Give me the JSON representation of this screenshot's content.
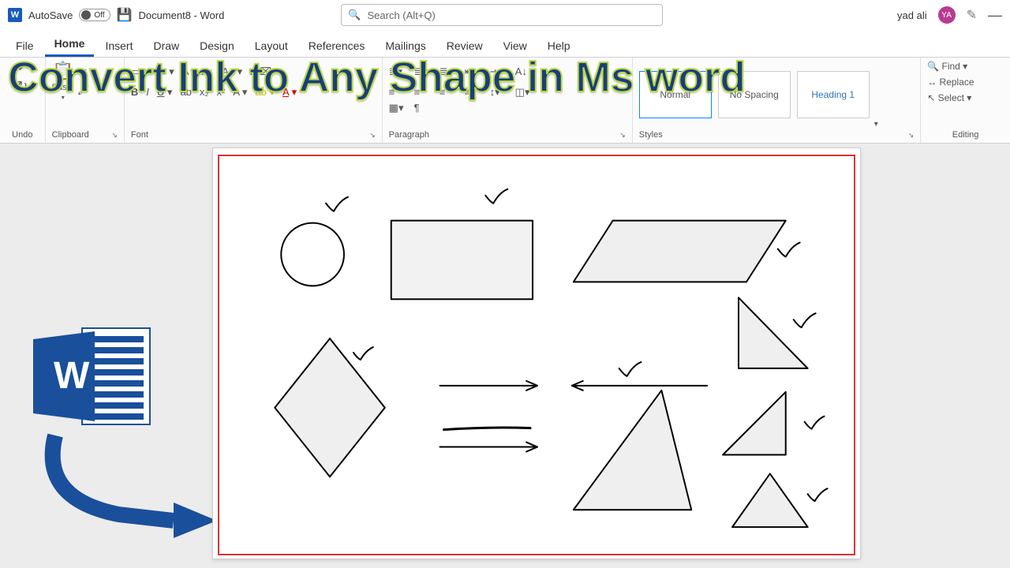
{
  "titlebar": {
    "autosave_label": "AutoSave",
    "autosave_state": "Off",
    "doc_title": "Document8 - Word",
    "search_placeholder": "Search (Alt+Q)",
    "user_name": "yad ali",
    "user_initials": "YA"
  },
  "tabs": [
    "File",
    "Home",
    "Insert",
    "Draw",
    "Design",
    "Layout",
    "References",
    "Mailings",
    "Review",
    "View",
    "Help"
  ],
  "active_tab": "Home",
  "ribbon": {
    "undo_group": "Undo",
    "clipboard_group": "Clipboard",
    "paste_label": "Paste",
    "font_group": "Font",
    "paragraph_group": "Paragraph",
    "styles_group": "Styles",
    "editing_group": "Editing",
    "style_normal": "Normal",
    "style_nospacing": "No Spacing",
    "style_heading": "Heading 1",
    "find_label": "Find",
    "replace_label": "Replace",
    "select_label": "Select"
  },
  "overlay": {
    "headline": "Convert Ink to Any Shape in Ms word"
  }
}
